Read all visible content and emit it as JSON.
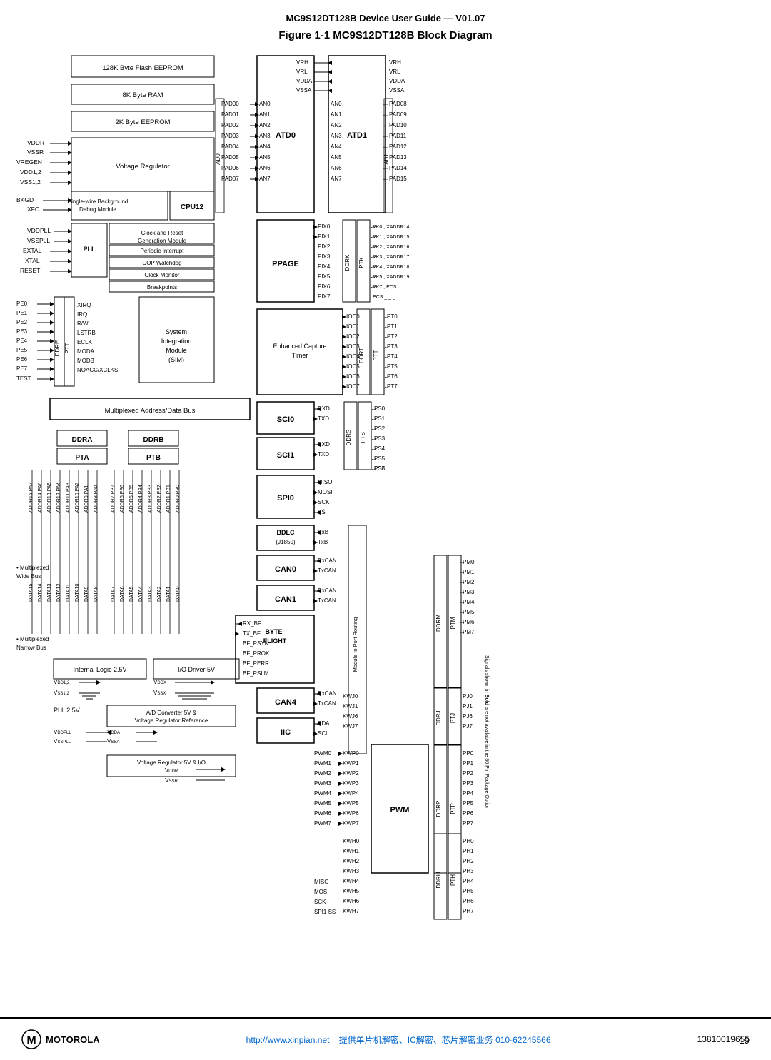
{
  "header": {
    "title": "MC9S12DT128B Device User Guide — V01.07"
  },
  "figure": {
    "title": "Figure 1-1  MC9S12DT128B Block Diagram"
  },
  "footer": {
    "logo_text": "MOTOROLA",
    "link": "http://www.xinpian.net",
    "center_text": "提供单片机解密、IC解密、芯片解密业务  010-62245566",
    "right_text": "13810019655"
  },
  "page_number": "19",
  "blocks": {
    "flash": "128K Byte Flash EEPROM",
    "ram": "8K Byte RAM",
    "eeprom": "2K Byte EEPROM",
    "voltage_reg": "Voltage Regulator",
    "debug": "Single-wire Background Debug Module",
    "cpu": "CPU12",
    "pll_module": "PLL",
    "clock_reset": "Clock and Reset Generation Module",
    "periodic_int": "Periodic Interrupt",
    "cop": "COP Watchdog",
    "clock_mon": "Clock Monitor",
    "breakpoints": "Breakpoints",
    "system_sim": "System Integration Module (SIM)",
    "ppage": "PPAGE",
    "enhanced_capture": "Enhanced Capture Timer",
    "sci0": "SCI0",
    "sci1": "SCI1",
    "spi0": "SPI0",
    "bdlc": "BDLC (J1850)",
    "can0": "CAN0",
    "can1": "CAN1",
    "byte_flight": "BYTE-FLIGHT",
    "can4": "CAN4",
    "iic": "IIC",
    "mux_addr": "Multiplexed Address/Data Bus",
    "mux_wide": "Multiplexed Wide Bus",
    "mux_narrow": "Multiplexed Narrow Bus",
    "internal_logic": "Internal Logic 2.5V",
    "io_driver": "I/O Driver 5V",
    "pll_25": "PLL 2.5V",
    "adc_ref": "A/D Converter 5V & Voltage Regulator Reference",
    "vreg_5v": "Voltage Regulator 5V & I/O",
    "ddra": "DDRA",
    "ddrb": "DDRB",
    "pta": "PTA",
    "ptb": "PTB",
    "module_port_routing": "Module to Port Routing"
  }
}
